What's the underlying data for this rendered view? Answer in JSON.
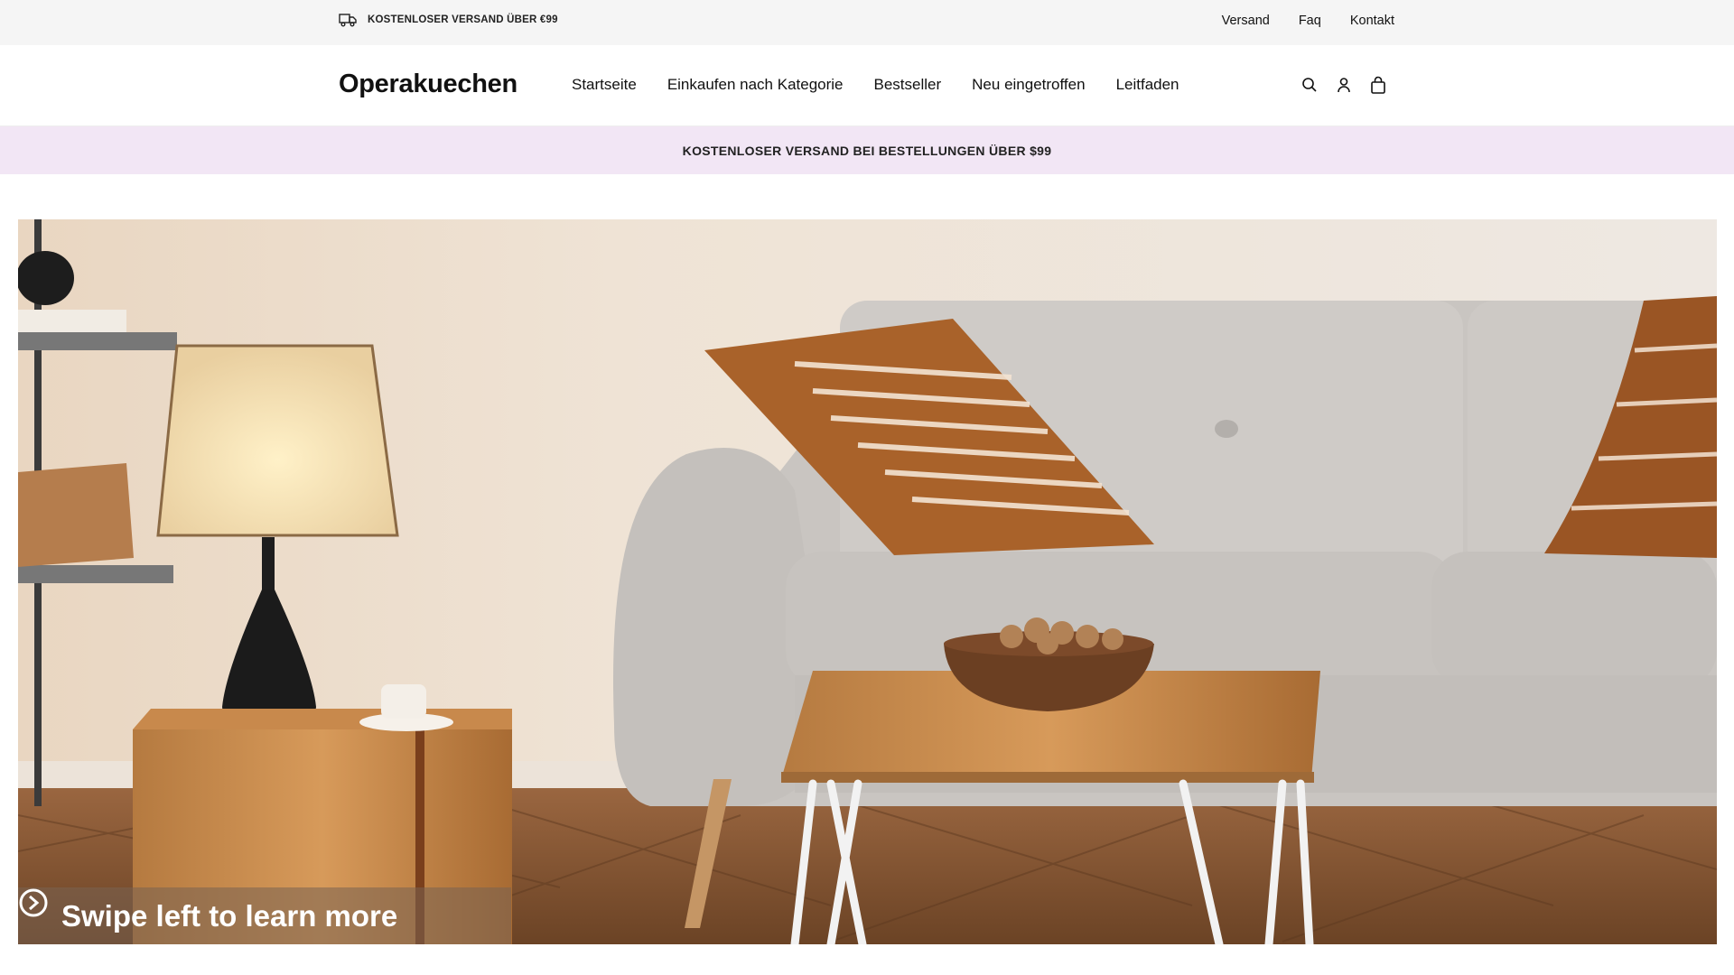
{
  "announcement": {
    "icon": "truck-icon",
    "text": "KOSTENLOSER VERSAND ÜBER €99"
  },
  "utility_links": [
    "Versand",
    "Faq",
    "Kontakt"
  ],
  "header": {
    "logo": "Operakuechen",
    "nav": [
      "Startseite",
      "Einkaufen nach Kategorie",
      "Bestseller",
      "Neu eingetroffen",
      "Leitfaden"
    ],
    "icons": [
      "search-icon",
      "account-icon",
      "cart-icon"
    ]
  },
  "promo_banner": {
    "text": "KOSTENLOSER VERSAND BEI BESTELLUNGEN ÜBER $99",
    "background": "#f2e6f5"
  },
  "hero": {
    "overlay_text": "Swipe left to learn more",
    "overlay_icon": "arrow-right-circle-icon"
  },
  "colors": {
    "utility_bar": "#f5f5f5",
    "promo_bg": "#f2e6f5",
    "text": "#111111"
  }
}
